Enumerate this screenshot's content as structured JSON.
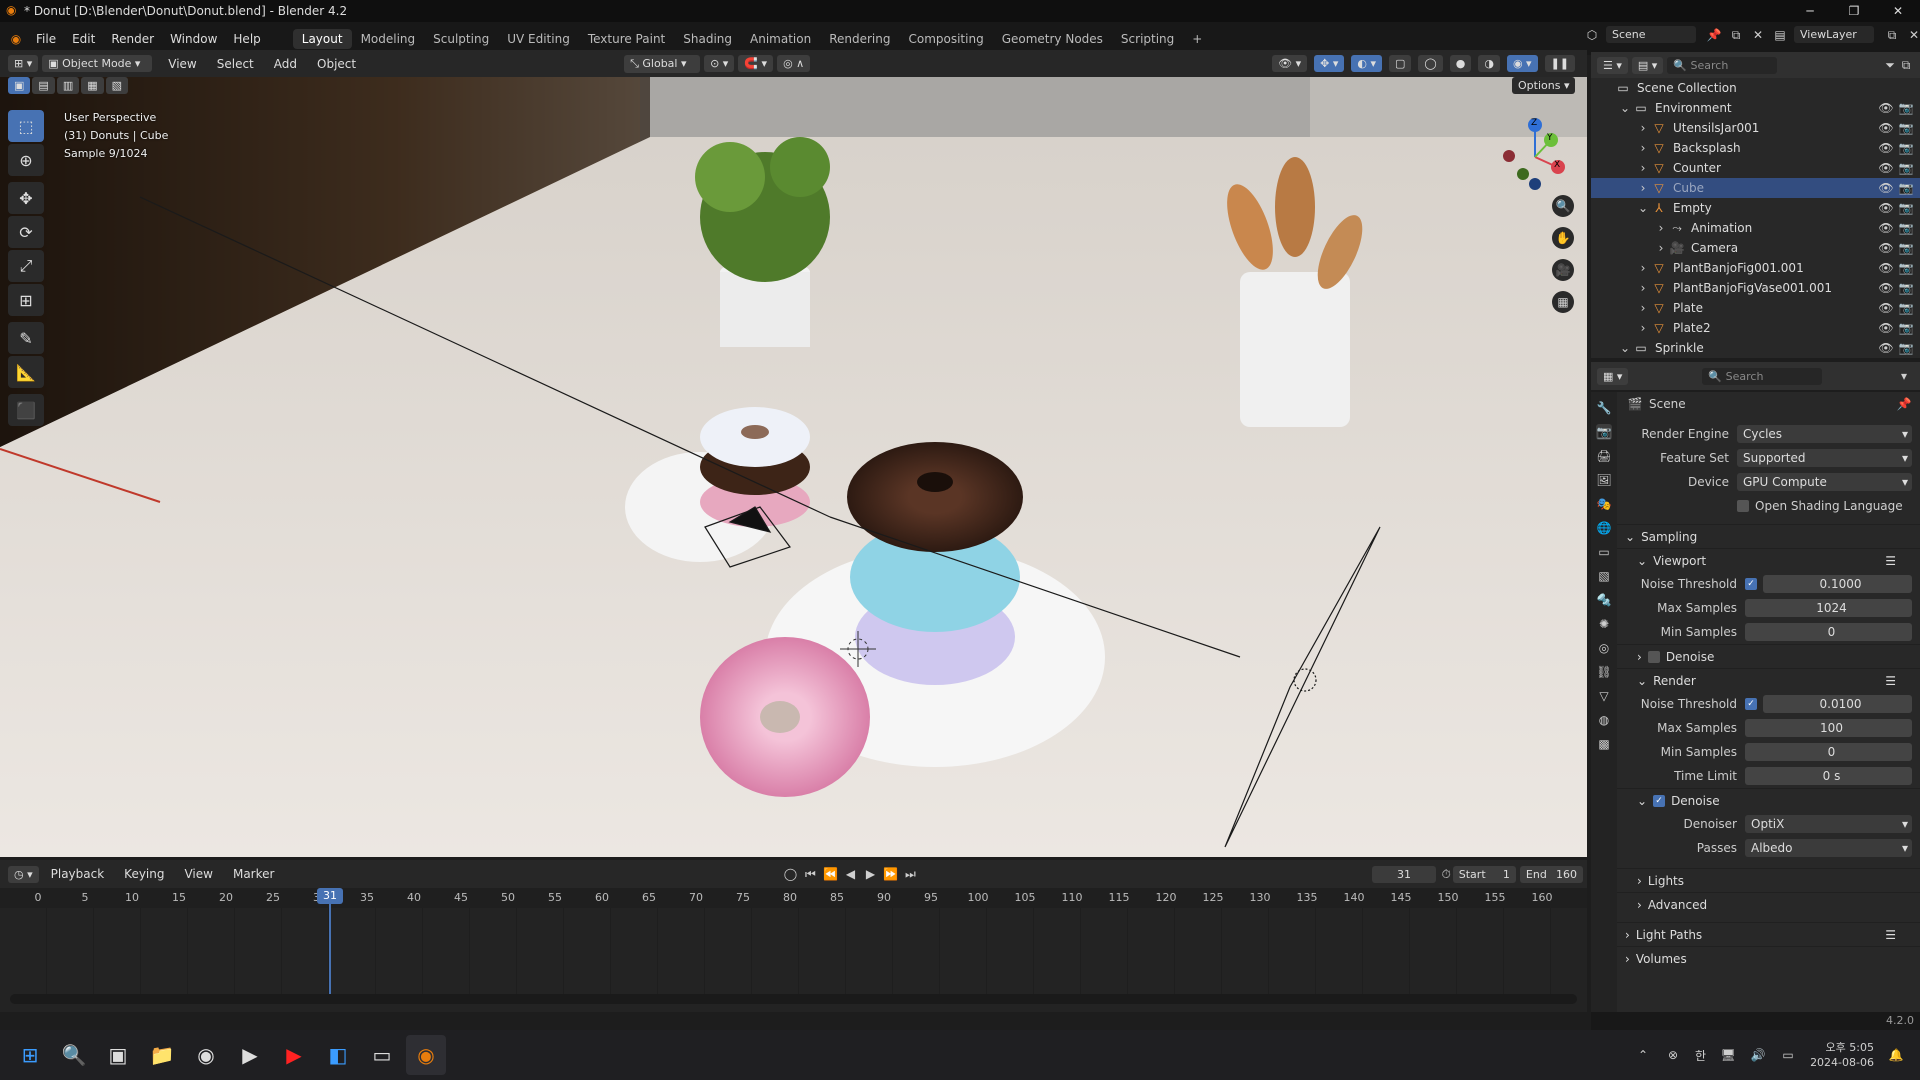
{
  "window": {
    "title": "* Donut [D:\\Blender\\Donut\\Donut.blend] - Blender 4.2",
    "minimize": "─",
    "maximize": "❐",
    "close": "✕"
  },
  "menu": [
    "File",
    "Edit",
    "Render",
    "Window",
    "Help"
  ],
  "workspaces": [
    "Layout",
    "Modeling",
    "Sculpting",
    "UV Editing",
    "Texture Paint",
    "Shading",
    "Animation",
    "Rendering",
    "Compositing",
    "Geometry Nodes",
    "Scripting"
  ],
  "workspace_add": "+",
  "scene_selector": {
    "scene": "Scene",
    "view_layer": "ViewLayer"
  },
  "viewport_header": {
    "mode": "Object Mode",
    "menus": [
      "View",
      "Select",
      "Add",
      "Object"
    ],
    "transform": "Global",
    "options": "Options"
  },
  "viewport_overlay": {
    "line1": "User Perspective",
    "line2": "(31) Donuts | Cube",
    "line3": "Sample 9/1024"
  },
  "gizmo": {
    "x": "X",
    "y": "Y",
    "z": "Z"
  },
  "outliner": {
    "search_placeholder": "Search",
    "items": [
      {
        "label": "Scene Collection",
        "indent": 0,
        "icon": "collection-icon",
        "selected": false
      },
      {
        "label": "Environment",
        "indent": 1,
        "icon": "collection-icon",
        "selected": false
      },
      {
        "label": "UtensilsJar001",
        "indent": 2,
        "icon": "mesh-icon",
        "selected": false
      },
      {
        "label": "Backsplash",
        "indent": 2,
        "icon": "mesh-icon",
        "selected": false
      },
      {
        "label": "Counter",
        "indent": 2,
        "icon": "mesh-icon",
        "selected": false
      },
      {
        "label": "Cube",
        "indent": 2,
        "icon": "mesh-icon",
        "selected": true
      },
      {
        "label": "Empty",
        "indent": 2,
        "icon": "empty-icon",
        "selected": false
      },
      {
        "label": "Animation",
        "indent": 3,
        "icon": "action-icon",
        "selected": false
      },
      {
        "label": "Camera",
        "indent": 3,
        "icon": "camera-icon",
        "selected": false
      },
      {
        "label": "PlantBanjoFig001.001",
        "indent": 2,
        "icon": "mesh-icon",
        "selected": false
      },
      {
        "label": "PlantBanjoFigVase001.001",
        "indent": 2,
        "icon": "mesh-icon",
        "selected": false
      },
      {
        "label": "Plate",
        "indent": 2,
        "icon": "mesh-icon",
        "selected": false
      },
      {
        "label": "Plate2",
        "indent": 2,
        "icon": "mesh-icon",
        "selected": false
      },
      {
        "label": "Sprinkle",
        "indent": 1,
        "icon": "collection-icon",
        "selected": false
      }
    ]
  },
  "properties": {
    "search_placeholder": "Search",
    "context": "Scene",
    "render_engine": {
      "label": "Render Engine",
      "value": "Cycles"
    },
    "feature_set": {
      "label": "Feature Set",
      "value": "Supported"
    },
    "device": {
      "label": "Device",
      "value": "GPU Compute"
    },
    "osl": "Open Shading Language",
    "sampling": "Sampling",
    "viewport": {
      "title": "Viewport",
      "noise_threshold": {
        "label": "Noise Threshold",
        "value": "0.1000",
        "enabled": true
      },
      "max_samples": {
        "label": "Max Samples",
        "value": "1024"
      },
      "min_samples": {
        "label": "Min Samples",
        "value": "0"
      },
      "denoise": "Denoise"
    },
    "render": {
      "title": "Render",
      "noise_threshold": {
        "label": "Noise Threshold",
        "value": "0.0100",
        "enabled": true
      },
      "max_samples": {
        "label": "Max Samples",
        "value": "100"
      },
      "min_samples": {
        "label": "Min Samples",
        "value": "0"
      },
      "time_limit": {
        "label": "Time Limit",
        "value": "0 s"
      },
      "denoise": "Denoise",
      "denoiser": {
        "label": "Denoiser",
        "value": "OptiX"
      },
      "passes": {
        "label": "Passes",
        "value": "Albedo"
      }
    },
    "lights": "Lights",
    "advanced": "Advanced",
    "light_paths": "Light Paths",
    "volumes": "Volumes"
  },
  "timeline": {
    "menus": [
      "Playback",
      "Keying",
      "View",
      "Marker"
    ],
    "current_frame": "31",
    "start_label": "Start",
    "start": "1",
    "end_label": "End",
    "end": "160",
    "ticks": [
      "0",
      "5",
      "10",
      "15",
      "20",
      "25",
      "30",
      "35",
      "40",
      "45",
      "50",
      "55",
      "60",
      "65",
      "70",
      "75",
      "80",
      "85",
      "90",
      "95",
      "100",
      "105",
      "110",
      "115",
      "120",
      "125",
      "130",
      "135",
      "140",
      "145",
      "150",
      "155",
      "160"
    ]
  },
  "version": "4.2.0",
  "taskbar": {
    "time": "오후 5:05",
    "date": "2024-08-06",
    "lang": "한"
  },
  "colors": {
    "accent": "#4772b3",
    "selected_row": "#334d80",
    "playhead": "#4772b3"
  }
}
